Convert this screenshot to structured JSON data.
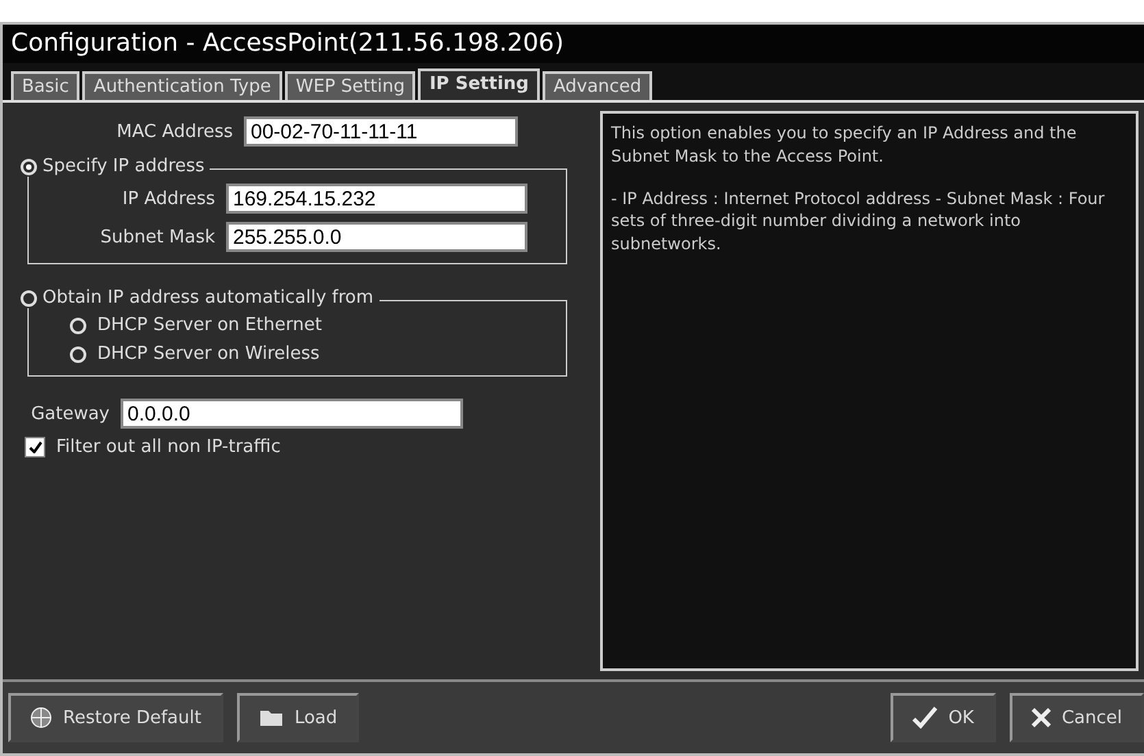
{
  "window": {
    "title": "Configuration - AccessPoint(211.56.198.206)"
  },
  "tabs": [
    {
      "label": "Basic",
      "selected": false
    },
    {
      "label": "Authentication Type",
      "selected": false
    },
    {
      "label": "WEP Setting",
      "selected": false
    },
    {
      "label": "IP Setting",
      "selected": true
    },
    {
      "label": "Advanced",
      "selected": false
    }
  ],
  "mac_address": {
    "label": "MAC Address",
    "value": "00-02-70-11-11-11"
  },
  "specify_group": {
    "label": "Specify IP address",
    "selected": true,
    "fields": [
      {
        "label": "IP Address",
        "value": "169.254.15.232"
      },
      {
        "label": "Subnet Mask",
        "value": "255.255.0.0"
      }
    ]
  },
  "obtain_group": {
    "label": "Obtain IP address automatically from",
    "selected": false,
    "options": [
      {
        "label": "DHCP Server on Ethernet",
        "selected": false
      },
      {
        "label": "DHCP Server on Wireless",
        "selected": false
      }
    ]
  },
  "gateway": {
    "label": "Gateway",
    "value": "0.0.0.0"
  },
  "filter": {
    "label": "Filter out all non IP-traffic",
    "checked": true
  },
  "description": [
    "This option enables you to specify an IP Address and the Subnet Mask to the Access Point.",
    "- IP Address : Internet Protocol address - Subnet Mask : Four sets of three-digit number dividing a network into subnetworks."
  ],
  "buttons": [
    {
      "label": "Restore Default",
      "kind": "restore"
    },
    {
      "label": "Load",
      "kind": "load"
    },
    {
      "label": "OK",
      "kind": "ok"
    },
    {
      "label": "Cancel",
      "kind": "cancel"
    }
  ]
}
